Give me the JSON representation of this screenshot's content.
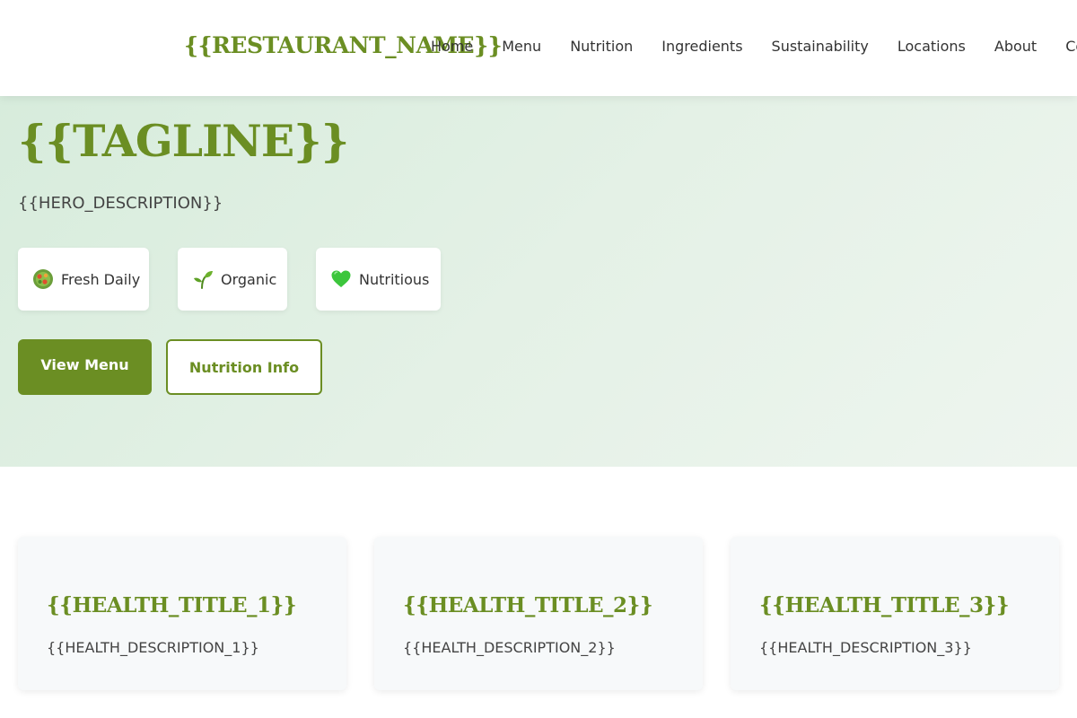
{
  "header": {
    "brand": "{{RESTAURANT_NAME}}",
    "nav": [
      "Home",
      "Menu",
      "Nutrition",
      "Ingredients",
      "Sustainability",
      "Locations",
      "About",
      "Contact"
    ]
  },
  "hero": {
    "tagline": "{{TAGLINE}}",
    "description": "{{HERO_DESCRIPTION}}",
    "badges": [
      {
        "icon": "salad-icon",
        "label": "Fresh Daily"
      },
      {
        "icon": "seedling-icon",
        "label": "Organic"
      },
      {
        "icon": "green-heart-icon",
        "label": "Nutritious"
      }
    ],
    "primary_button": "View Menu",
    "secondary_button": "Nutrition Info"
  },
  "health": [
    {
      "title": "{{HEALTH_TITLE_1}}",
      "description": "{{HEALTH_DESCRIPTION_1}}"
    },
    {
      "title": "{{HEALTH_TITLE_2}}",
      "description": "{{HEALTH_DESCRIPTION_2}}"
    },
    {
      "title": "{{HEALTH_TITLE_3}}",
      "description": "{{HEALTH_DESCRIPTION_3}}"
    }
  ],
  "colors": {
    "accent": "#6b8e23",
    "hero_bg": "#e1efe3"
  }
}
